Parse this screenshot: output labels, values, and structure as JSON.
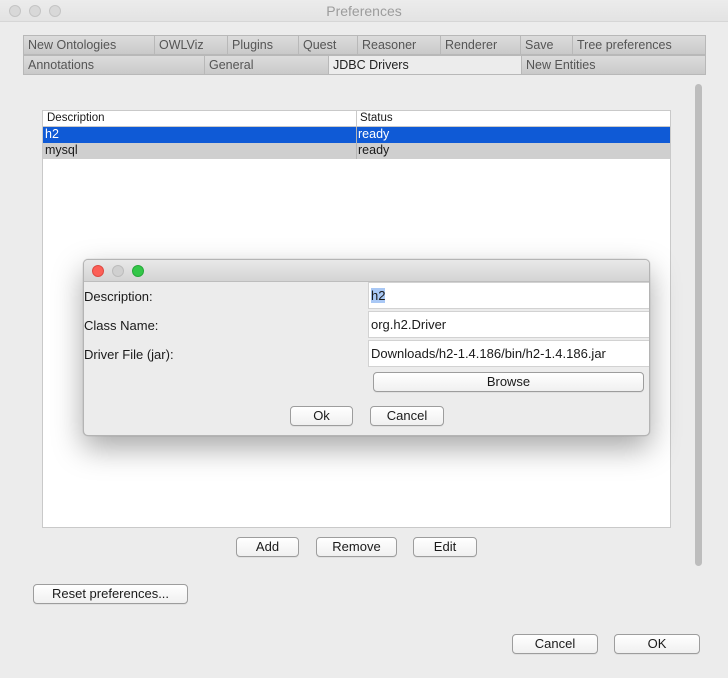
{
  "window": {
    "title": "Preferences"
  },
  "tabs": {
    "row1": [
      {
        "label": "New Ontologies"
      },
      {
        "label": "OWLViz"
      },
      {
        "label": "Plugins"
      },
      {
        "label": "Quest"
      },
      {
        "label": "Reasoner"
      },
      {
        "label": "Renderer"
      },
      {
        "label": "Save"
      },
      {
        "label": "Tree preferences"
      }
    ],
    "row2": [
      {
        "label": "Annotations"
      },
      {
        "label": "General"
      },
      {
        "label": "JDBC Drivers",
        "active": true
      },
      {
        "label": "New Entities"
      }
    ]
  },
  "drivers_table": {
    "columns": [
      "Description",
      "Status"
    ],
    "rows": [
      {
        "description": "h2",
        "status": "ready",
        "selected": true
      },
      {
        "description": "mysql",
        "status": "ready",
        "selected": false
      }
    ]
  },
  "driver_buttons": {
    "add": "Add",
    "remove": "Remove",
    "edit": "Edit"
  },
  "reset_button": "Reset preferences...",
  "footer": {
    "cancel": "Cancel",
    "ok": "OK"
  },
  "dialog": {
    "fields": [
      {
        "label": "Description:",
        "value": "h2"
      },
      {
        "label": "Class Name:",
        "value": "org.h2.Driver"
      },
      {
        "label": "Driver File (jar):",
        "value": "Downloads/h2-1.4.186/bin/h2-1.4.186.jar"
      }
    ],
    "browse": "Browse",
    "ok": "Ok",
    "cancel": "Cancel"
  },
  "colors": {
    "selection": "#0f5ad6",
    "close_dot": "#fc5f57",
    "minimize_dot": "#d0d0d0",
    "zoom_dot": "#33c748"
  }
}
